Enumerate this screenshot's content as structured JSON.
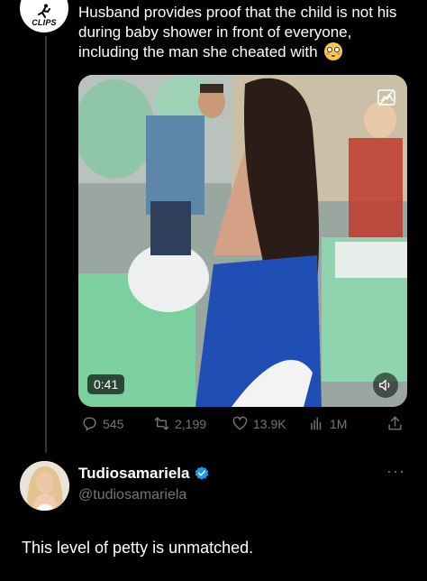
{
  "tweet": {
    "account_badge": "CLIPS",
    "text": "Husband provides proof that the child is not his during baby shower in front of everyone, including the man she cheated with",
    "emoji": "flushed-face",
    "video": {
      "duration": "0:41",
      "muted_icon": "speaker-icon"
    },
    "metrics": {
      "replies": "545",
      "retweets": "2,199",
      "likes": "13.9K",
      "views": "1M"
    }
  },
  "reply": {
    "display_name": "Tudiosamariela",
    "handle": "@tudiosamariela",
    "verified": true,
    "more_label": "···",
    "text": "This level of petty is unmatched."
  },
  "colors": {
    "background": "#000000",
    "text": "#e7e9ea",
    "muted": "#71767b",
    "verified": "#1d9bf0"
  }
}
